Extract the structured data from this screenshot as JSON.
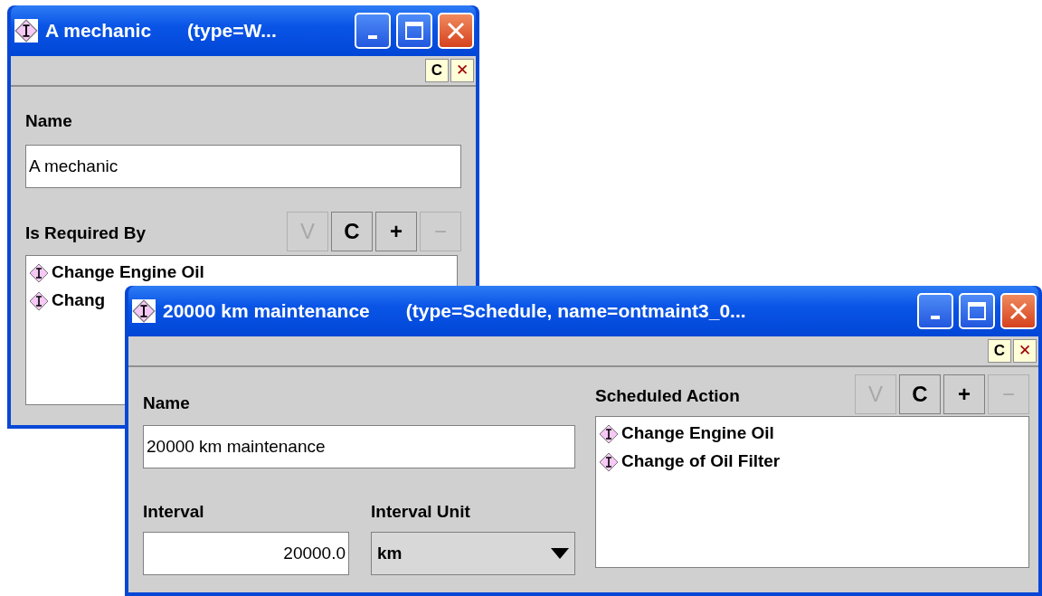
{
  "windows": [
    {
      "title": "A mechanic",
      "type_info": "(type=W...",
      "toolbar_buttons": [
        "C",
        "✕"
      ],
      "name_field": {
        "label": "Name",
        "value": "A mechanic"
      },
      "list": {
        "label": "Is Required By",
        "buttons": [
          {
            "label": "V",
            "disabled": true
          },
          {
            "label": "C",
            "disabled": false
          },
          {
            "label": "+",
            "disabled": false
          },
          {
            "label": "−",
            "disabled": true
          }
        ],
        "items": [
          "Change Engine Oil",
          "Chang"
        ]
      }
    },
    {
      "title": "20000 km maintenance",
      "type_info": "(type=Schedule, name=ontmaint3_0...",
      "toolbar_buttons": [
        "C",
        "✕"
      ],
      "name_field": {
        "label": "Name",
        "value": "20000 km maintenance"
      },
      "interval_field": {
        "label": "Interval",
        "value": "20000.0"
      },
      "unit_select": {
        "label": "Interval Unit",
        "value": "km"
      },
      "list": {
        "label": "Scheduled Action",
        "buttons": [
          {
            "label": "V",
            "disabled": true
          },
          {
            "label": "C",
            "disabled": false
          },
          {
            "label": "+",
            "disabled": false
          },
          {
            "label": "−",
            "disabled": true
          }
        ],
        "items": [
          "Change Engine Oil",
          "Change of Oil Filter"
        ]
      }
    }
  ]
}
